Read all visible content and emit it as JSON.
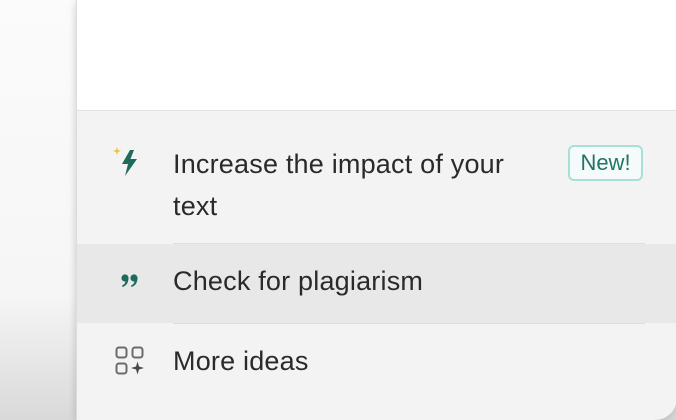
{
  "menu": {
    "items": [
      {
        "label": "Increase the impact of your text",
        "icon": "lightning-sparkle-icon",
        "badge": "New!"
      },
      {
        "label": "Check for plagiarism",
        "icon": "quote-icon"
      },
      {
        "label": "More ideas",
        "icon": "apps-sparkle-icon"
      }
    ]
  },
  "colors": {
    "accent": "#1e6b5e",
    "sparkle": "#f2c230",
    "badge_border": "#a8e0d6",
    "hover_bg": "#e8e8e8"
  }
}
